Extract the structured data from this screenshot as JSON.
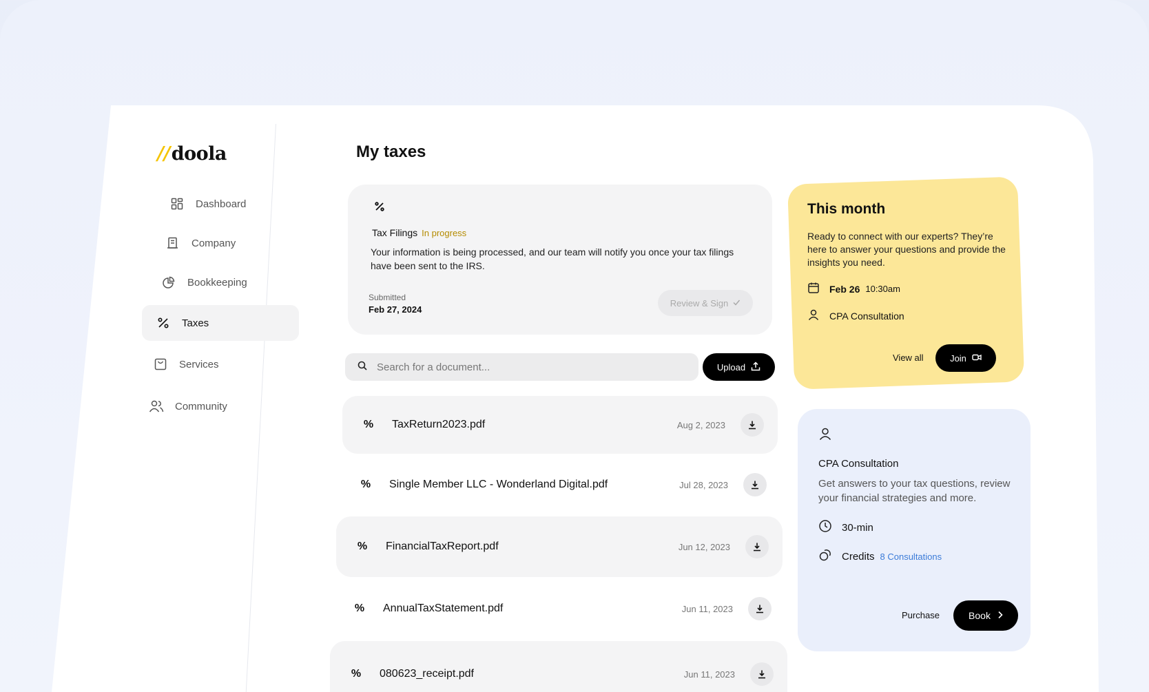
{
  "brand": {
    "logo_mark": "//",
    "logo_text": "doola"
  },
  "sidebar": {
    "items": [
      {
        "label": "Dashboard",
        "icon": "grid-icon"
      },
      {
        "label": "Company",
        "icon": "building-icon"
      },
      {
        "label": "Bookkeeping",
        "icon": "pie-chart-icon"
      },
      {
        "label": "Taxes",
        "icon": "percent-icon",
        "active": true
      },
      {
        "label": "Services",
        "icon": "bag-icon"
      },
      {
        "label": "Community",
        "icon": "users-icon"
      }
    ]
  },
  "main": {
    "title": "My taxes",
    "status_card": {
      "icon": "percent-icon",
      "title": "Tax Filings",
      "badge": "In progress",
      "description": "Your information is being processed, and our team will notify you once your tax filings have been sent to the IRS.",
      "submitted_label": "Submitted",
      "submitted_date": "Feb 27, 2024",
      "review_button": "Review & Sign"
    },
    "search": {
      "placeholder": "Search for a document..."
    },
    "upload_button": "Upload",
    "documents": [
      {
        "name": "TaxReturn2023.pdf",
        "date": "Aug 2, 2023"
      },
      {
        "name": "Single Member LLC - Wonderland Digital.pdf",
        "date": "Jul 28, 2023"
      },
      {
        "name": "FinancialTaxReport.pdf",
        "date": "Jun 12, 2023"
      },
      {
        "name": "AnnualTaxStatement.pdf",
        "date": "Jun 11, 2023"
      },
      {
        "name": "080623_receipt.pdf",
        "date": "Jun 11, 2023"
      }
    ]
  },
  "this_month": {
    "title": "This month",
    "description": "Ready to connect with our experts? They’re here to answer your questions and provide the insights you need.",
    "date": "Feb 26",
    "time": "10:30am",
    "event": "CPA Consultation",
    "view_all": "View all",
    "join_button": "Join",
    "color": "#fce798"
  },
  "cpa_card": {
    "title": "CPA Consultation",
    "description": "Get answers to your tax questions, review your financial strategies and more.",
    "duration": "30-min",
    "credits_label": "Credits",
    "credits_value": "8 Consultations",
    "purchase": "Purchase",
    "book_button": "Book",
    "color": "#eaeffb"
  }
}
